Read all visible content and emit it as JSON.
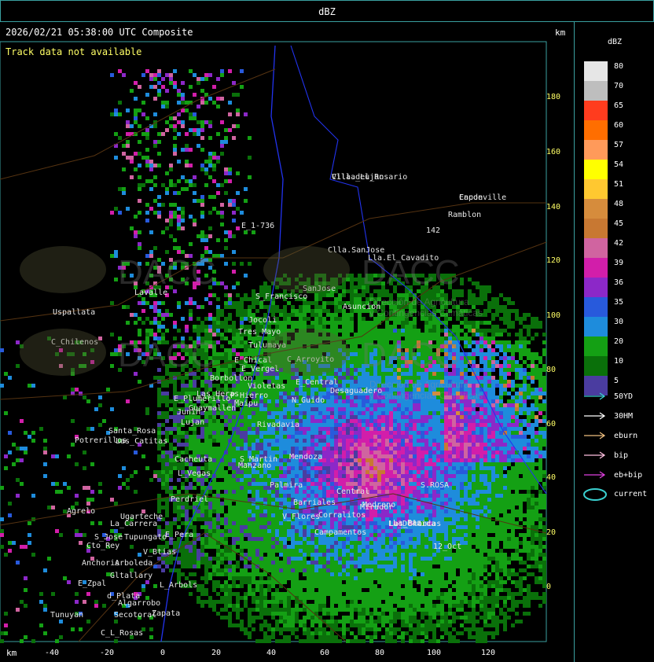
{
  "window": {
    "title": "dBZ"
  },
  "header": {
    "timestamp": "2026/02/21 05:38:00 UTC Composite",
    "track_message": "Track data not available",
    "km_label_top": "km",
    "km_label_bottom": "km"
  },
  "axes": {
    "y_ticks": [
      "180",
      "160",
      "140",
      "120",
      "100",
      "80",
      "60",
      "40",
      "20",
      "0"
    ],
    "x_ticks": [
      "-40",
      "-20",
      "0",
      "20",
      "40",
      "60",
      "80",
      "100",
      "120"
    ]
  },
  "watermark": {
    "brand": "DACC",
    "line1": "Dirección de Agricultura",
    "line2": "y Contingencias Climáticas"
  },
  "places": [
    "Clla.del_Rosario",
    "Encon",
    "142",
    "E_1-736",
    "Ramblon",
    "Clla.SanJose",
    "Lla.El_Cavadito",
    "SanJose",
    "Asuncion",
    "Uspallata",
    "C_Chilenos",
    "Tres_Mayo",
    "Jocoli",
    "S_Francisco",
    "Lavalle",
    "Tulumaya",
    "Desaguadero",
    "Las_Heras",
    "Borbollon",
    "E_Chical",
    "E_Vergel",
    "C_Arroyito",
    "Violetas",
    "P_Hierro",
    "E_Central",
    "N_Guido",
    "E_Plumerillo",
    "Mendoza",
    "Junin",
    "Guaymallen",
    "Maipu",
    "Lujan",
    "Rivadavia",
    "S_Martin",
    "Palmira",
    "Barriales",
    "Medrano",
    "La_Paz",
    "Santa_Rosa",
    "Las_Catitas",
    "Potrerillos",
    "Cacheuta",
    "L_Vegas",
    "Perdriel",
    "Agrelo",
    "Ugarteche",
    "La_Carrera",
    "Cto_Rey",
    "S_Jose",
    "Tupungato",
    "E_Pera",
    "V_Btias",
    "Anchoris",
    "Arboleda",
    "Gltallary",
    "E_Zpal",
    "d_Plata",
    "L_Arbols",
    "Algarrobo",
    "Zapata",
    "Secotoral",
    "Tunuyan",
    "C_L_Rosas",
    "Manzano",
    "V_Flores",
    "Corralitos",
    "Campamentos",
    "Central",
    "Mirador",
    "12_Oct",
    "S.ROSA",
    "La_Dormida",
    "Las_Blancas",
    "Villa_Lujan",
    "Capdeville"
  ],
  "legend": {
    "title": "dBZ",
    "colors": [
      {
        "value": "80",
        "color": "#e6e6e6"
      },
      {
        "value": "70",
        "color": "#bebebe"
      },
      {
        "value": "65",
        "color": "#ff3c1e"
      },
      {
        "value": "60",
        "color": "#ff6e00"
      },
      {
        "value": "57",
        "color": "#ff9a5a"
      },
      {
        "value": "54",
        "color": "#ffff00"
      },
      {
        "value": "51",
        "color": "#ffc830"
      },
      {
        "value": "48",
        "color": "#d68c3c"
      },
      {
        "value": "45",
        "color": "#c87832"
      },
      {
        "value": "42",
        "color": "#d064a0"
      },
      {
        "value": "39",
        "color": "#d21eaa"
      },
      {
        "value": "36",
        "color": "#8c28c8"
      },
      {
        "value": "35",
        "color": "#285adc"
      },
      {
        "value": "30",
        "color": "#1e8cdc"
      },
      {
        "value": "20",
        "color": "#14a014"
      },
      {
        "value": "10",
        "color": "#0a700a"
      },
      {
        "value": "5",
        "color": "#4a3ca0"
      }
    ],
    "tracks": [
      {
        "label": "50YD",
        "color": "#3ad0d0"
      },
      {
        "label": "30HM",
        "color": "#ffffff"
      },
      {
        "label": "eburn",
        "color": "#f0c080"
      },
      {
        "label": "bip",
        "color": "#ffc0e0"
      },
      {
        "label": "eb+bip",
        "color": "#e040e0"
      }
    ],
    "current_label": "current",
    "current_color": "#3ad0d0"
  }
}
